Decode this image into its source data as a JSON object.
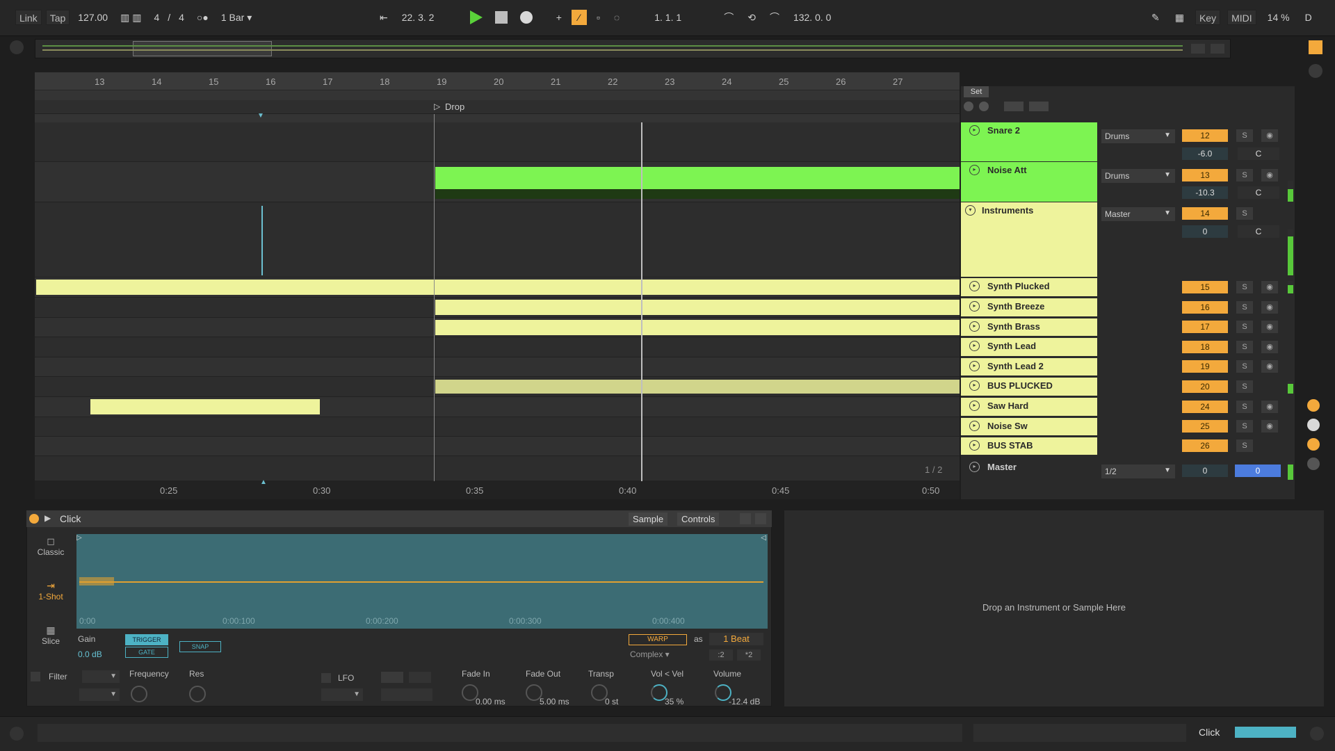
{
  "transport": {
    "link": "Link",
    "tap": "Tap",
    "tempo": "127.00",
    "time_sig_num": "4",
    "time_sig_sep": "/",
    "time_sig_den": "4",
    "quantize": "1 Bar",
    "position": "22.   3.   2",
    "loop_start": "1.   1.   1",
    "loop_length": "132.   0.   0",
    "key": "Key",
    "midi": "MIDI",
    "cpu": "14 %",
    "disk": "D"
  },
  "arrangement": {
    "bars": [
      "13",
      "14",
      "15",
      "16",
      "17",
      "18",
      "19",
      "20",
      "21",
      "22",
      "23",
      "24",
      "25",
      "26",
      "27"
    ],
    "locator": "Drop",
    "times": [
      "0:25",
      "0:30",
      "0:35",
      "0:40",
      "0:45",
      "0:50"
    ],
    "page_indicator": "1 / 2"
  },
  "set": {
    "label": "Set"
  },
  "tracks": [
    {
      "name": "Snare 2",
      "route": "Drums",
      "num": "12",
      "vol": "-6.0",
      "pan": "C",
      "color": "#7df452"
    },
    {
      "name": "Noise Att",
      "route": "Drums",
      "num": "13",
      "vol": "-10.3",
      "pan": "C",
      "color": "#7df452"
    },
    {
      "name": "Instruments",
      "route": "Master",
      "num": "14",
      "vol": "0",
      "pan": "C",
      "color": "#eef39c"
    },
    {
      "name": "Synth Plucked",
      "num": "15",
      "color": "#eef39c"
    },
    {
      "name": "Synth Breeze",
      "num": "16",
      "color": "#eef39c"
    },
    {
      "name": "Synth Brass",
      "num": "17",
      "color": "#eef39c"
    },
    {
      "name": "Synth Lead",
      "num": "18",
      "color": "#eef39c"
    },
    {
      "name": "Synth Lead 2",
      "num": "19",
      "color": "#eef39c"
    },
    {
      "name": "BUS PLUCKED",
      "num": "20",
      "color": "#eef39c"
    },
    {
      "name": "Saw Hard",
      "num": "24",
      "color": "#eef39c"
    },
    {
      "name": "Noise Sw",
      "num": "25",
      "color": "#eef39c"
    },
    {
      "name": "BUS STAB",
      "num": "26",
      "color": "#eef39c"
    }
  ],
  "master": {
    "name": "Master",
    "route": "1/2",
    "vol": "0",
    "pan": "0"
  },
  "device": {
    "title": "Click",
    "tab_sample": "Sample",
    "tab_controls": "Controls",
    "mode_classic": "Classic",
    "mode_oneshot": "1-Shot",
    "mode_slice": "Slice",
    "wave_times": [
      "0:00",
      "0:00:100",
      "0:00:200",
      "0:00:300",
      "0:00:400"
    ],
    "gain_label": "Gain",
    "gain_value": "0.0 dB",
    "trigger": "TRIGGER",
    "gate": "GATE",
    "snap": "SNAP",
    "warp": "WARP",
    "as": "as",
    "beat": "1 Beat",
    "warp_mode": "Complex ▾",
    "half": ":2",
    "double": "*2",
    "filter": "Filter",
    "frequency": "Frequency",
    "res": "Res",
    "lfo": "LFO",
    "fade_in": "Fade In",
    "fade_in_val": "0.00 ms",
    "fade_out": "Fade Out",
    "fade_out_val": "5.00 ms",
    "transp": "Transp",
    "transp_val": "0 st",
    "vol_vel": "Vol < Vel",
    "vol_vel_val": "35 %",
    "volume": "Volume",
    "volume_val": "-12.4 dB"
  },
  "drop_hint": "Drop an Instrument or Sample Here",
  "status": {
    "right_label": "Click"
  },
  "colors": {
    "green": "#7df452",
    "yellow": "#eef39c",
    "orange": "#f3a93c",
    "blue": "#4c7cde",
    "teal": "#3c6c74"
  }
}
